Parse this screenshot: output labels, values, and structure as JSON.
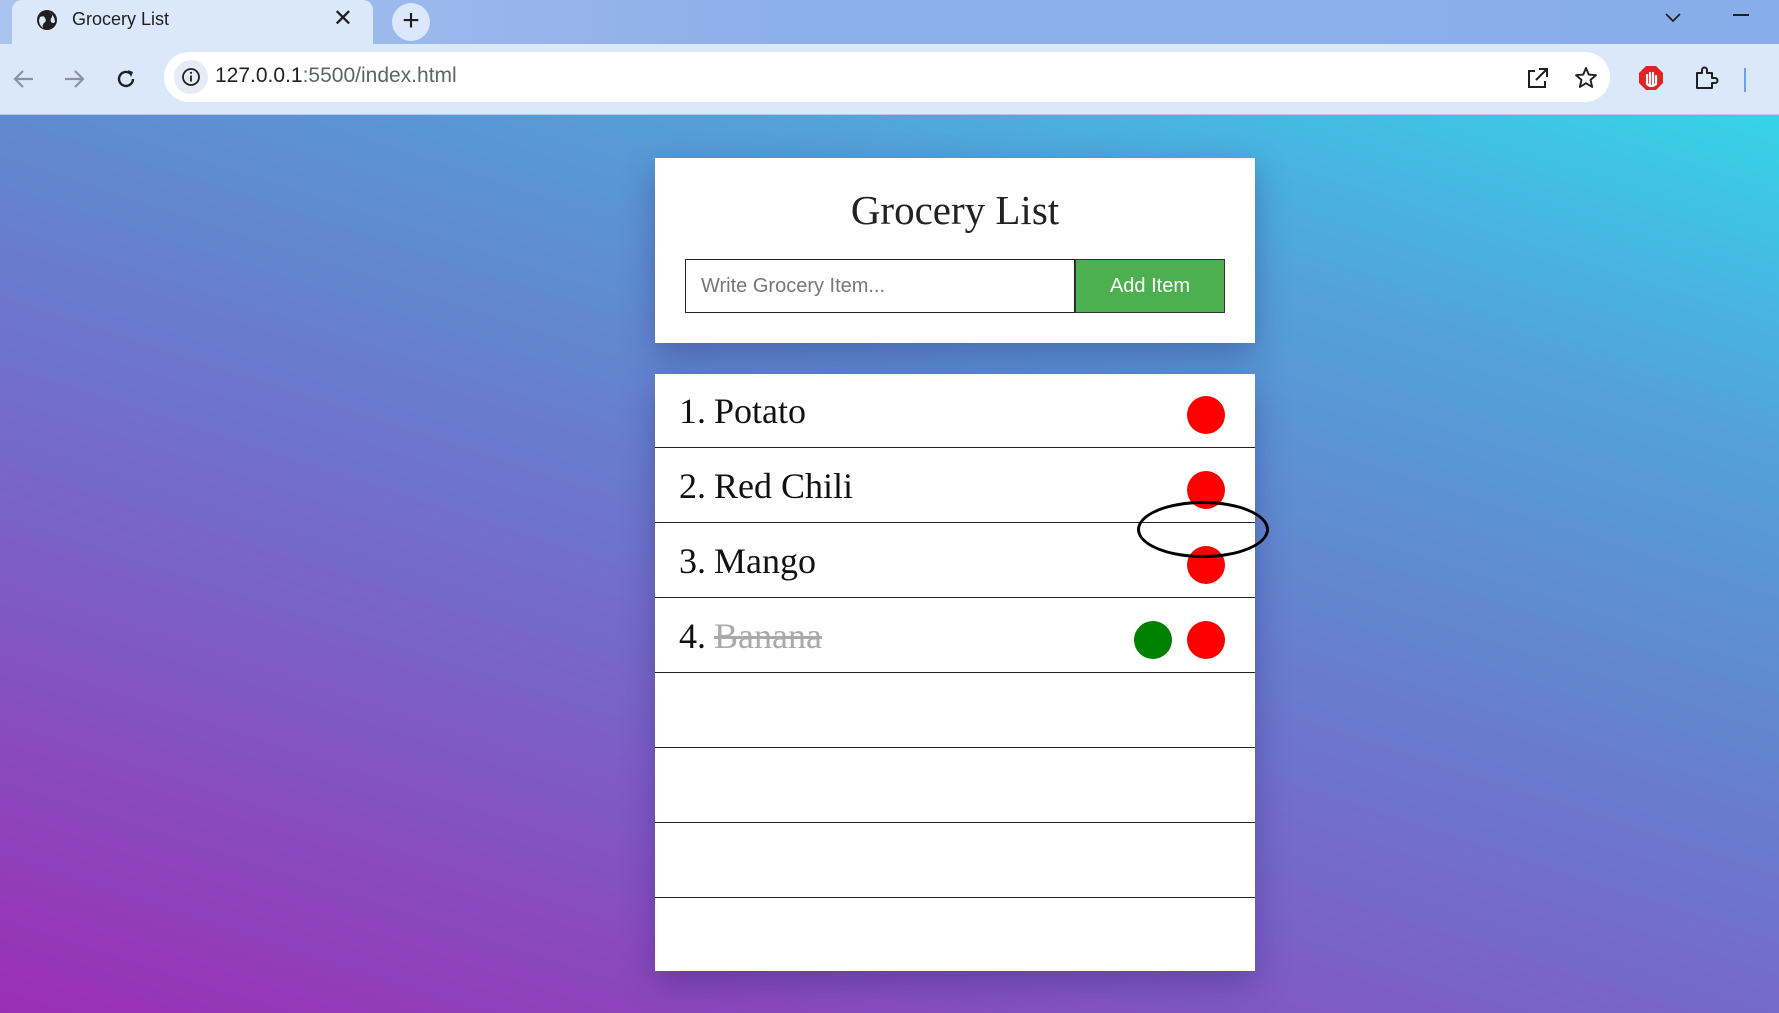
{
  "browser": {
    "tab_title": "Grocery List",
    "tab_close": "✕",
    "new_tab": "+",
    "url_host": "127.0.0.1",
    "url_path": ":5500/index.html"
  },
  "app": {
    "title": "Grocery List",
    "input_placeholder": "Write Grocery Item...",
    "add_button_label": "Add Item",
    "items": [
      {
        "number": "1.",
        "text": "Potato",
        "done": false
      },
      {
        "number": "2.",
        "text": "Red Chili",
        "done": false
      },
      {
        "number": "3.",
        "text": "Mango",
        "done": false
      },
      {
        "number": "4.",
        "text": "Banana",
        "done": true
      }
    ]
  },
  "colors": {
    "delete_dot": "#ff0000",
    "done_dot": "#008000",
    "add_button": "#4caf50"
  }
}
